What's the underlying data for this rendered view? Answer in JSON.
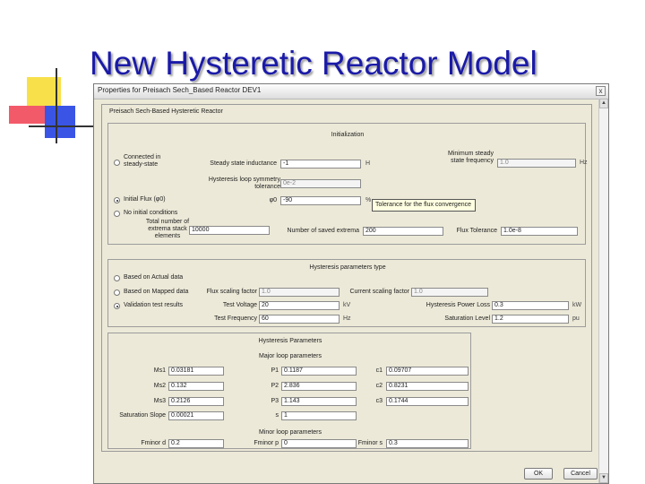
{
  "slide": {
    "title": "New Hysteretic Reactor Model"
  },
  "dialog": {
    "title": "Properties for Preisach Sech_Based Reactor DEV1",
    "group_title": "Preisach Sech-Based Hysteretic Reactor",
    "close_symbol": "x",
    "ok_label": "OK",
    "cancel_label": "Cancel"
  },
  "init": {
    "header": "Initialization",
    "radio_connected": "Connected in steady-state",
    "radio_initial_flux": "Initial Flux (φ0)",
    "radio_no_initial": "No initial conditions",
    "selected": "initial_flux",
    "steady_inductance_label": "Steady state inductance",
    "steady_inductance_value": "-1",
    "steady_inductance_unit": "H",
    "min_freq_label": "Minimum steady state frequency",
    "min_freq_value": "1.0",
    "min_freq_unit": "Hz",
    "symmetry_label": "Hysteresis loop symmetry tolerance",
    "symmetry_value": "0e-2",
    "phi0_label": "φ0",
    "phi0_value": "-90",
    "phi0_unit": "%",
    "tooltip": "Tolerance for the flux convergence",
    "total_stack_label": "Total number of extrema stack elements",
    "total_stack_value": "10000",
    "saved_extrema_label": "Number of saved extrema",
    "saved_extrema_value": "200",
    "flux_tolerance_label": "Flux Tolerance",
    "flux_tolerance_value": "1.0e-8"
  },
  "hyst_type": {
    "header": "Hysteresis parameters type",
    "radio_actual": "Based on Actual data",
    "radio_mapped": "Based on Mapped data",
    "radio_validation": "Validation test results",
    "selected": "validation",
    "flux_scaling_label": "Flux scaling factor",
    "flux_scaling_value": "1.0",
    "current_scaling_label": "Current scaling factor",
    "current_scaling_value": "1.0",
    "test_voltage_label": "Test Voltage",
    "test_voltage_value": "20",
    "test_voltage_unit": "kV",
    "hyst_power_loss_label": "Hysteresis Power Loss",
    "hyst_power_loss_value": "0.3",
    "hyst_power_loss_unit": "kW",
    "test_freq_label": "Test Frequency",
    "test_freq_value": "60",
    "test_freq_unit": "Hz",
    "saturation_level_label": "Saturation Level",
    "saturation_level_value": "1.2",
    "saturation_level_unit": "pu"
  },
  "hyst_params": {
    "header": "Hysteresis Parameters",
    "major_header": "Major loop parameters",
    "ms1_label": "Ms1",
    "ms1_value": "0.03181",
    "ms2_label": "Ms2",
    "ms2_value": "0.132",
    "ms3_label": "Ms3",
    "ms3_value": "0.2126",
    "p1_label": "P1",
    "p1_value": "0.1187",
    "p2_label": "P2",
    "p2_value": "2.836",
    "p3_label": "P3",
    "p3_value": "1.143",
    "c1_label": "c1",
    "c1_value": "0.09707",
    "c2_label": "c2",
    "c2_value": "0.8231",
    "c3_label": "c3",
    "c3_value": "0.1744",
    "sat_slope_label": "Saturation Slope",
    "sat_slope_value": "0.00021",
    "s_label": "s",
    "s_value": "1",
    "minor_header": "Minor loop parameters",
    "fminor_d_label": "Fminor d",
    "fminor_d_value": "0.2",
    "fminor_p_label": "Fminor p",
    "fminor_p_value": "0",
    "fminor_s_label": "Fminor s",
    "fminor_s_value": "0.3"
  }
}
